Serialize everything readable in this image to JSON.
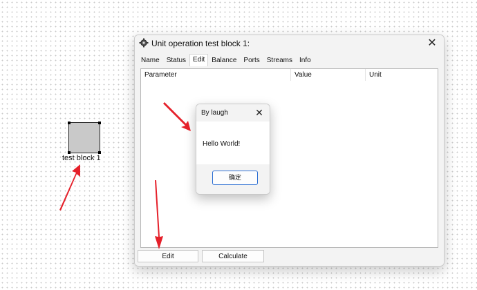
{
  "canvas": {
    "block_label": "test block 1"
  },
  "window": {
    "title": "Unit operation test block 1:",
    "close_icon": "close-icon",
    "tabs": [
      {
        "label": "Name"
      },
      {
        "label": "Status"
      },
      {
        "label": "Edit",
        "active": true
      },
      {
        "label": "Balance"
      },
      {
        "label": "Ports"
      },
      {
        "label": "Streams"
      },
      {
        "label": "Info"
      }
    ],
    "table": {
      "columns": [
        "Parameter",
        "Value",
        "Unit"
      ],
      "rows": []
    },
    "buttons": {
      "edit": "Edit",
      "calculate": "Calculate"
    }
  },
  "message_box": {
    "title": "By laugh",
    "message": "Hello World!",
    "ok_label": "确定"
  },
  "annotations": {
    "arrow_color": "#e5202a",
    "arrow_count": 3
  }
}
